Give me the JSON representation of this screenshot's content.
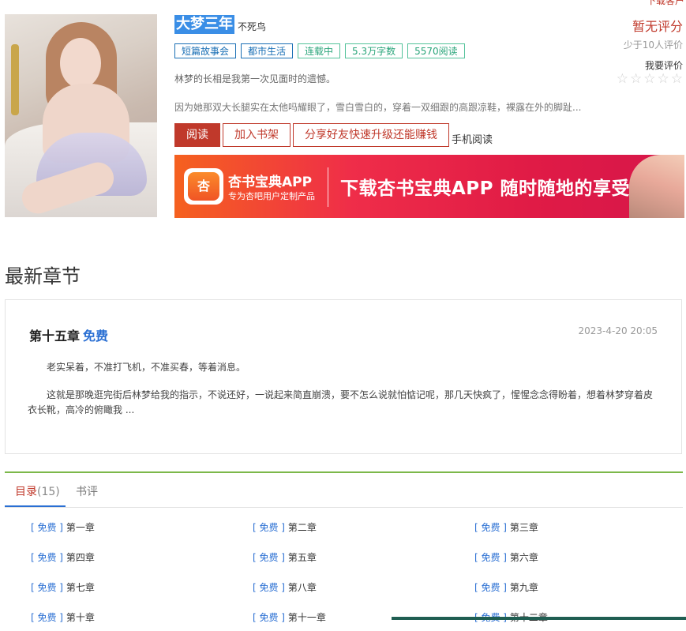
{
  "top_link": "下载客户",
  "book": {
    "title": "大梦三年",
    "author": "不死鸟",
    "tags": [
      "短篇故事会",
      "都市生活",
      "连载中",
      "5.3万字数",
      "5570阅读"
    ],
    "intro_line1": "林梦的长相是我第一次见面时的遗憾。",
    "intro_line2": "因为她那双大长腿实在太他吗耀眼了，雪白雪白的，穿着一双细跟的高跟凉鞋，裸露在外的脚趾...",
    "score": "暂无评分",
    "raters": "少于10人评价",
    "rate_link": "我要评价",
    "stars": [
      "☆",
      "☆",
      "☆",
      "☆",
      "☆"
    ]
  },
  "actions": {
    "read": "阅读",
    "shelf": "加入书架",
    "share": "分享好友快速升级还能赚钱",
    "mobile": "手机阅读"
  },
  "banner": {
    "app_icon": "杏",
    "app_name": "杏书宝典APP",
    "app_sub": "专为杏吧用户定制产品",
    "slogan": "下载杏书宝典APP 随时随地的享受"
  },
  "latest": {
    "section_title": "最新章节",
    "chapter": "第十五章",
    "free": "免费",
    "time": "2023-4-20 20:05",
    "p1": "老实呆着，不准打飞机，不准买春，等着消息。",
    "p2": "这就是那晚逛完街后林梦给我的指示，不说还好，一说起来简直崩溃，要不怎么说就怕惦记呢，那几天快疯了，惺惺念念得盼着，想着林梦穿着皮衣长靴，高冷的俯瞰我 ..."
  },
  "tabs": {
    "toc_label": "目录",
    "toc_count": "(15)",
    "review_label": "书评"
  },
  "toc": {
    "free_label": "[ 免费 ]",
    "chapters": [
      "第一章",
      "第二章",
      "第三章",
      "第四章",
      "第五章",
      "第六章",
      "第七章",
      "第八章",
      "第九章",
      "第十章",
      "第十一章",
      "第十二章"
    ]
  }
}
